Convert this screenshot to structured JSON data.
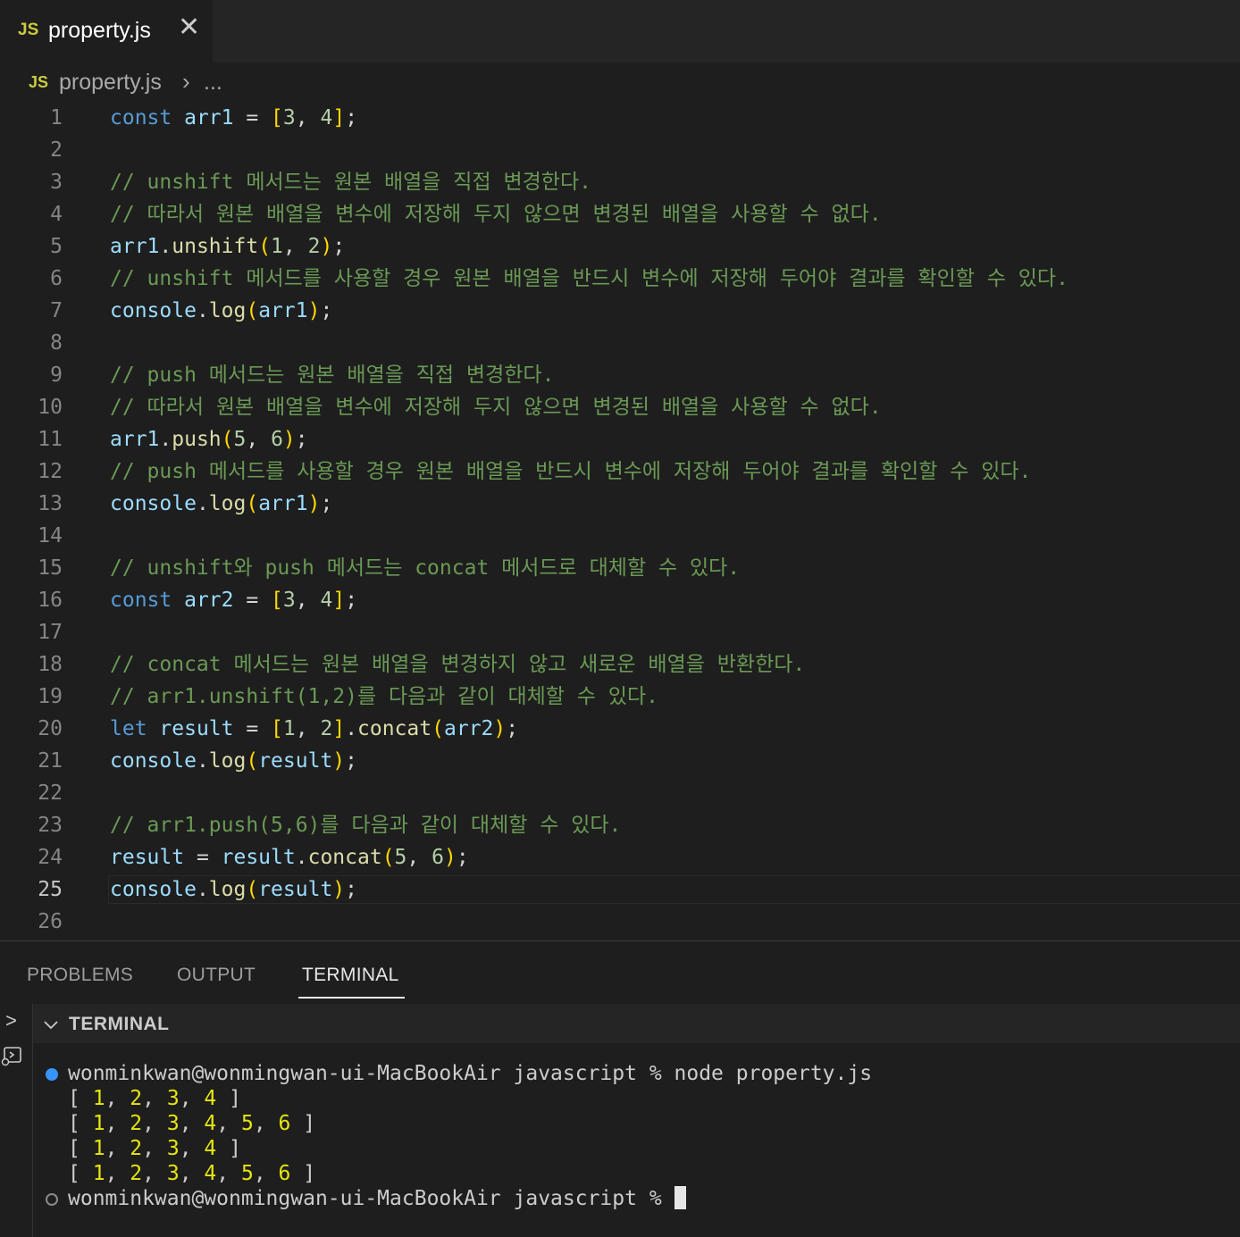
{
  "tab": {
    "lang_badge": "JS",
    "filename": "property.js",
    "close_glyph": "✕"
  },
  "breadcrumb": {
    "lang_badge": "JS",
    "file": "property.js",
    "separator": "›",
    "more": "..."
  },
  "editor": {
    "active_line": 25,
    "lines": [
      {
        "num": "1",
        "text": "const arr1 = [3, 4];"
      },
      {
        "num": "2",
        "text": ""
      },
      {
        "num": "3",
        "text": "// unshift 메서드는 원본 배열을 직접 변경한다."
      },
      {
        "num": "4",
        "text": "// 따라서 원본 배열을 변수에 저장해 두지 않으면 변경된 배열을 사용할 수 없다."
      },
      {
        "num": "5",
        "text": "arr1.unshift(1, 2);"
      },
      {
        "num": "6",
        "text": "// unshift 메서드를 사용할 경우 원본 배열을 반드시 변수에 저장해 두어야 결과를 확인할 수 있다."
      },
      {
        "num": "7",
        "text": "console.log(arr1);"
      },
      {
        "num": "8",
        "text": ""
      },
      {
        "num": "9",
        "text": "// push 메서드는 원본 배열을 직접 변경한다."
      },
      {
        "num": "10",
        "text": "// 따라서 원본 배열을 변수에 저장해 두지 않으면 변경된 배열을 사용할 수 없다."
      },
      {
        "num": "11",
        "text": "arr1.push(5, 6);"
      },
      {
        "num": "12",
        "text": "// push 메서드를 사용할 경우 원본 배열을 반드시 변수에 저장해 두어야 결과를 확인할 수 있다."
      },
      {
        "num": "13",
        "text": "console.log(arr1);"
      },
      {
        "num": "14",
        "text": ""
      },
      {
        "num": "15",
        "text": "// unshift와 push 메서드는 concat 메서드로 대체할 수 있다."
      },
      {
        "num": "16",
        "text": "const arr2 = [3, 4];"
      },
      {
        "num": "17",
        "text": ""
      },
      {
        "num": "18",
        "text": "// concat 메서드는 원본 배열을 변경하지 않고 새로운 배열을 반환한다."
      },
      {
        "num": "19",
        "text": "// arr1.unshift(1,2)를 다음과 같이 대체할 수 있다."
      },
      {
        "num": "20",
        "text": "let result = [1, 2].concat(arr2);"
      },
      {
        "num": "21",
        "text": "console.log(result);"
      },
      {
        "num": "22",
        "text": ""
      },
      {
        "num": "23",
        "text": "// arr1.push(5,6)를 다음과 같이 대체할 수 있다."
      },
      {
        "num": "24",
        "text": "result = result.concat(5, 6);"
      },
      {
        "num": "25",
        "text": "console.log(result);"
      },
      {
        "num": "26",
        "text": ""
      }
    ]
  },
  "panel": {
    "tabs": [
      {
        "label": "PROBLEMS"
      },
      {
        "label": "OUTPUT"
      },
      {
        "label": "TERMINAL"
      }
    ],
    "active_tab": "TERMINAL",
    "section_title": "TERMINAL",
    "terminal": {
      "prompt1": "wonminkwan@wonmingwan-ui-MacBookAir javascript % node property.js",
      "outputs": [
        "[ 1, 2, 3, 4 ]",
        "[ 1, 2, 3, 4, 5, 6 ]",
        "[ 1, 2, 3, 4 ]",
        "[ 1, 2, 3, 4, 5, 6 ]"
      ],
      "prompt2": "wonminkwan@wonmingwan-ui-MacBookAir javascript % "
    }
  },
  "colors": {
    "background": "#1e1e1e",
    "comment": "#6a9955",
    "keyword": "#569cd6",
    "variable": "#9cdcfe",
    "function": "#dcdcaa",
    "number": "#b5cea8",
    "bracket_gold": "#ffd700",
    "bracket_purple": "#da70d6",
    "terminal_number": "#e5e510",
    "js_badge": "#cbcb41",
    "success_dot": "#3794ff"
  }
}
